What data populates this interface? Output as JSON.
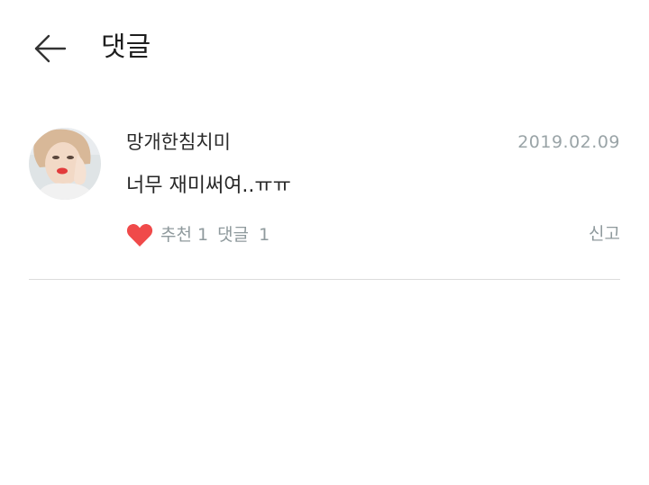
{
  "header": {
    "title": "댓글",
    "back_icon": "arrow-left-icon"
  },
  "comment": {
    "author": "망개한침치미",
    "date": "2019.02.09",
    "text": "너무 재미써여..ㅠㅠ",
    "likes_label": "추천",
    "likes_count": "1",
    "replies_label": "댓글",
    "replies_count": "1",
    "report_label": "신고",
    "heart_color": "#f04a4a",
    "heart_icon": "heart-icon",
    "avatar": "user-avatar"
  }
}
